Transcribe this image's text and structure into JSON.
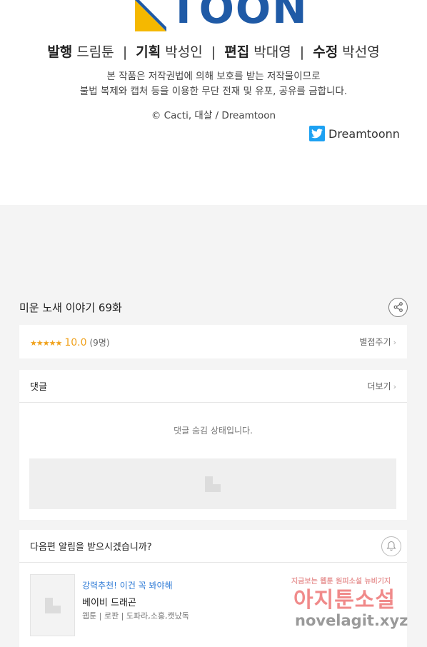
{
  "credits": {
    "logo_text": "TOON",
    "staff": [
      {
        "role": "발행",
        "value": "드림툰"
      },
      {
        "role": "기획",
        "value": "박성인"
      },
      {
        "role": "편집",
        "value": "박대영"
      },
      {
        "role": "수정",
        "value": "박선영"
      }
    ],
    "separator": "|",
    "notice_line1": "본 작품은 저작권법에 의해 보호를 받는 저작물이므로",
    "notice_line2": "불법 복제와 캡처 등을 이용한 무단 전재 및 유포, 공유를 금합니다.",
    "copyright": "© Cacti, 대살 / Dreamtoon",
    "twitter_handle": "Dreamtoonn"
  },
  "episode": {
    "title": "미운 노새 이야기 69화"
  },
  "rating": {
    "stars": "★★★★★",
    "score": "10.0",
    "count": "(9명)",
    "rate_link": "별점주기",
    "chevron": "›"
  },
  "comments": {
    "title": "댓글",
    "more": "더보기",
    "hidden_message": "댓글 숨김 상태입니다."
  },
  "alarm": {
    "title": "다음편 알림을 받으시겠습니까?"
  },
  "recommendation": {
    "tag": "강력추천! 이건 꼭 봐야해",
    "name": "베이비 드래곤",
    "genre": "웹툰 | 로판 | 도파라,소홍,캣났독"
  },
  "watermark": {
    "top": "지금보는 웹툰 원피소설 뉴비기지",
    "main": "아지툰소설",
    "url": "novelagit.xyz"
  },
  "colors": {
    "brand_blue": "#1f5aa6",
    "brand_yellow": "#f5b800",
    "rating_orange": "#f0a11a",
    "link_blue": "#2f7bd6",
    "twitter_blue": "#1da1f2"
  }
}
